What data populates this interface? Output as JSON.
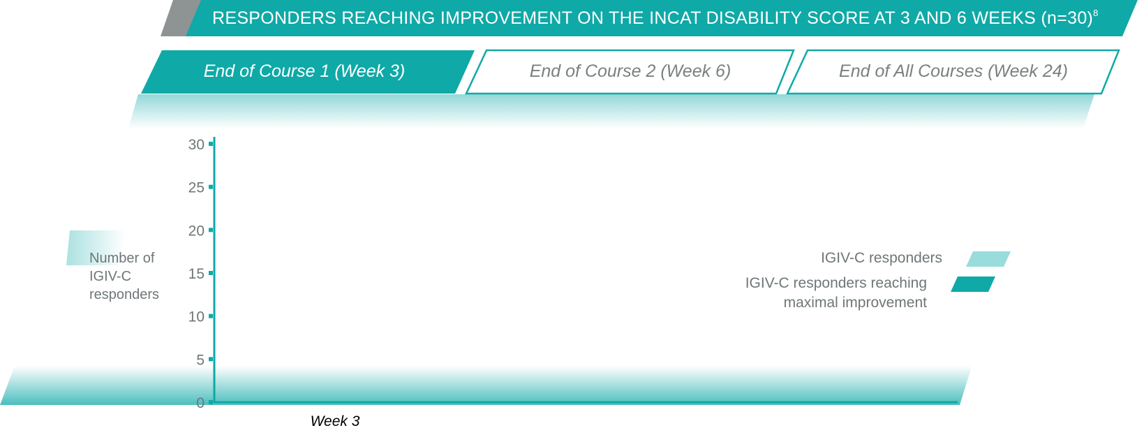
{
  "colors": {
    "teal": "#0fa9a7",
    "teal_light": "#98dcdb",
    "banner_grey": "#8e9394",
    "text_grey": "#6f7678"
  },
  "title": {
    "text": "RESPONDERS REACHING IMPROVEMENT ON THE INCAT DISABILITY SCORE AT 3 AND 6 WEEKS (n=30)",
    "superscript": "8"
  },
  "tabs": [
    {
      "label": "End of Course 1 (Week 3)",
      "active": true
    },
    {
      "label": "End of Course 2 (Week 6)",
      "active": false
    },
    {
      "label": "End of All Courses (Week 24)",
      "active": false
    }
  ],
  "chart_data": {
    "type": "bar",
    "title": "",
    "ylabel": "Number of IGIV-C responders",
    "xlabel": "",
    "ylim": [
      0,
      30
    ],
    "yticks": [
      0,
      5,
      10,
      15,
      20,
      25,
      30
    ],
    "categories": [
      "Week 3"
    ],
    "series": [
      {
        "name": "IGIV-C responders",
        "values": [
          null
        ],
        "color": "#98dcdb"
      },
      {
        "name": "IGIV-C responders reaching maximal improvement",
        "values": [
          null
        ],
        "color": "#0fa9a7"
      }
    ],
    "legend_position": "right",
    "grid": false
  },
  "legend": {
    "items": [
      {
        "label_lines": [
          "IGIV-C responders"
        ],
        "color": "#98dcdb"
      },
      {
        "label_lines": [
          "IGIV-C responders reaching",
          "maximal improvement"
        ],
        "color": "#0fa9a7"
      }
    ]
  },
  "y_axis_label_lines": [
    "Number of",
    "IGIV-C",
    "responders"
  ]
}
